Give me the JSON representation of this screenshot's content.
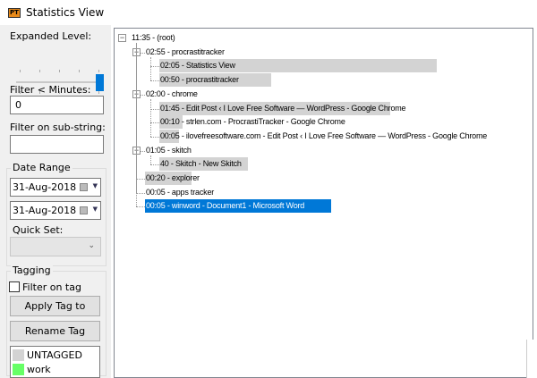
{
  "window": {
    "title": "Statistics View",
    "icon": "PT"
  },
  "left": {
    "expanded_label": "Expanded Level:",
    "expanded_level": 5,
    "expanded_max": 5,
    "filter_minutes_label": "Filter < Minutes:",
    "filter_minutes_value": "0",
    "filter_sub_label": "Filter on sub-string:",
    "filter_sub_value": "",
    "date_range_label": "Date Range",
    "date_from": "31-Aug-2018",
    "date_to": "31-Aug-2018",
    "quick_set_label": "Quick Set:",
    "quick_set_value": "",
    "tagging_label": "Tagging",
    "filter_on_tag_label": "Filter on tag",
    "filter_on_tag_checked": false,
    "apply_tag_label": "Apply Tag to Node",
    "rename_tag_label": "Rename Tag",
    "tags": [
      {
        "name": "UNTAGGED",
        "color": "#d3d3d3"
      },
      {
        "name": "work",
        "color": "#66ff66"
      }
    ]
  },
  "tree": [
    {
      "text": "11:35 - (root)",
      "level": 0,
      "toggle": "minus"
    },
    {
      "text": "02:55 - procrastitracker",
      "level": 1,
      "toggle": "minus"
    },
    {
      "text": "02:05 - Statistics View",
      "level": 2,
      "fraction": 0.72
    },
    {
      "text": "00:50 - procrastitracker",
      "level": 2,
      "fraction": 0.29
    },
    {
      "text": "02:00 - chrome",
      "level": 1,
      "toggle": "minus"
    },
    {
      "text": "01:45 - Edit Post ‹ I Love Free Software — WordPress - Google Chrome",
      "level": 2,
      "fraction": 0.6
    },
    {
      "text": "00:10 - strlen.com - ProcrastiTracker - Google Chrome",
      "level": 2,
      "fraction": 0.06
    },
    {
      "text": "00:05 - ilovefreesoftware.com - Edit Post ‹ I Love Free Software — WordPress - Google Chrome",
      "level": 2,
      "fraction": 0.02
    },
    {
      "text": "01:05 - skitch",
      "level": 1,
      "toggle": "minus"
    },
    {
      "text": "40 - Skitch - New Skitch",
      "level": 2,
      "fraction": 0.23
    },
    {
      "text": "00:20 - explorer",
      "level": 1,
      "fraction": 0.12
    },
    {
      "text": "00:05 - apps tracker",
      "level": 1
    },
    {
      "text": "00:05 - winword - Document1 - Microsoft Word",
      "level": 1,
      "selected": true
    }
  ]
}
